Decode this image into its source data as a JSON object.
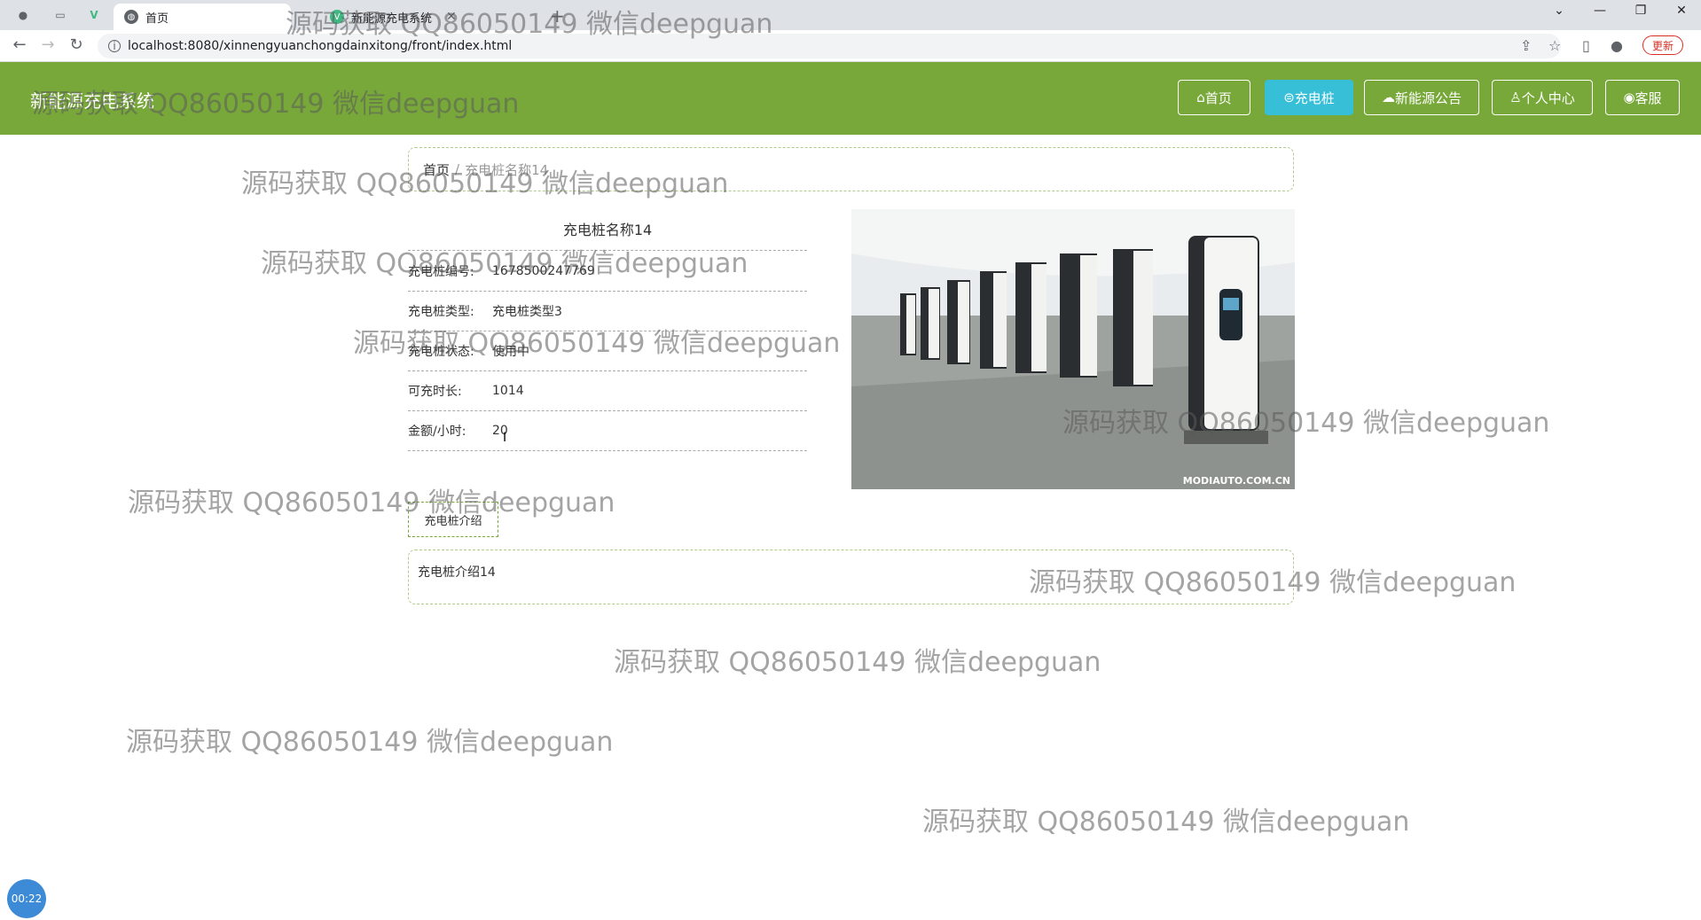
{
  "browser": {
    "tabs": [
      {
        "title": "首页",
        "active": true
      },
      {
        "title": "新能源充电系统",
        "active": false
      }
    ],
    "new_tab": "+",
    "url": "localhost:8080/xinnengyuanchongdainxitong/front/index.html",
    "update_label": "更新"
  },
  "site": {
    "title": "新能源充电系统",
    "nav": [
      {
        "icon": "home-icon",
        "label": "首页"
      },
      {
        "icon": "charger-icon",
        "label": "充电桩"
      },
      {
        "icon": "cloud-icon",
        "label": "新能源公告"
      },
      {
        "icon": "user-icon",
        "label": "个人中心"
      },
      {
        "icon": "chat-icon",
        "label": "客服"
      }
    ],
    "active_nav": "充电桩"
  },
  "breadcrumb": {
    "home": "首页",
    "separator": "/",
    "current": "充电桩名称14"
  },
  "detail": {
    "title": "充电桩名称14",
    "fields": [
      {
        "label": "充电桩编号:",
        "value": "1678500247769"
      },
      {
        "label": "充电桩类型:",
        "value": "充电桩类型3"
      },
      {
        "label": "充电桩状态:",
        "value": "使用中"
      },
      {
        "label": "可充时长:",
        "value": "1014"
      },
      {
        "label": "金额/小时:",
        "value": "20"
      }
    ],
    "photo_caption": "MODIAUTO.COM.CN"
  },
  "intro": {
    "tab_label": "充电桩介绍",
    "content": "充电桩介绍14"
  },
  "timer": "00:22",
  "watermark_text": "源码获取 QQ86050149 微信deepguan",
  "colors": {
    "header": "#78a83a",
    "active_nav": "#36bfd7"
  }
}
